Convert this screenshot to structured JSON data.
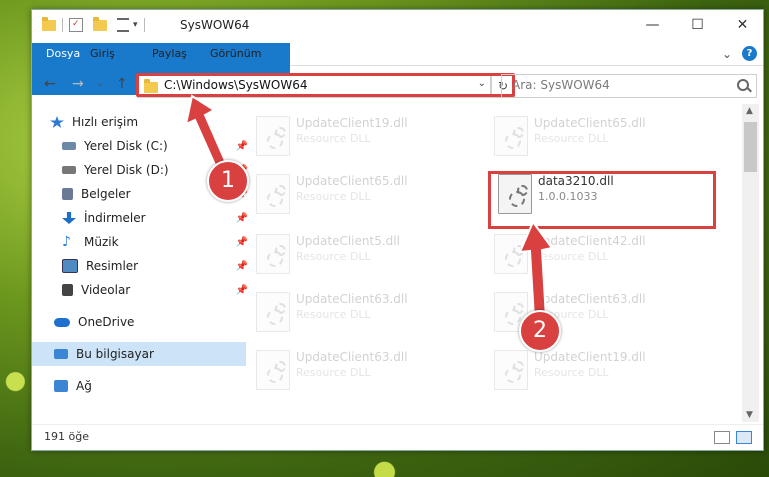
{
  "window": {
    "title": "SysWOW64",
    "buttons": {
      "minimize": "—",
      "maximize": "☐",
      "close": "✕"
    }
  },
  "ribbon": {
    "tabs": [
      "Dosya",
      "Giriş",
      "Paylaş",
      "Görünüm"
    ],
    "help": "?",
    "expand": "⌄"
  },
  "nav": {
    "back": "←",
    "forward": "→",
    "recent": "⌄",
    "up": "↑",
    "address": "C:\\Windows\\SysWOW64",
    "address_dropdown": "⌄",
    "refresh": "↻",
    "search_placeholder": "Ara: SysWOW64"
  },
  "sidebar": {
    "items": [
      {
        "label": "Hızlı erişim",
        "icon": "star-icon",
        "color": "#2d7bd1"
      },
      {
        "label": "Yerel Disk (C:)",
        "icon": "drive-icon",
        "color": "#6c8aa8"
      },
      {
        "label": "Yerel Disk (D:)",
        "icon": "drive-icon",
        "color": "#777777"
      },
      {
        "label": "Belgeler",
        "icon": "document-icon",
        "color": "#6a7a96"
      },
      {
        "label": "İndirmeler",
        "icon": "download-icon",
        "color": "#1b6fc9"
      },
      {
        "label": "Müzik",
        "icon": "music-icon",
        "color": "#2a7fd4"
      },
      {
        "label": "Resimler",
        "icon": "pictures-icon",
        "color": "#4f8bc0"
      },
      {
        "label": "Videolar",
        "icon": "video-icon",
        "color": "#444444"
      },
      {
        "label": "OneDrive",
        "icon": "cloud-icon",
        "color": "#1f6fce"
      },
      {
        "label": "Bu bilgisayar",
        "icon": "computer-icon",
        "color": "#3b86d4"
      },
      {
        "label": "Ağ",
        "icon": "network-icon",
        "color": "#3b86d4"
      }
    ]
  },
  "files": [
    {
      "name": "UpdateClient19.dll",
      "desc": "Resource DLL"
    },
    {
      "name": "UpdateClient65.dll",
      "desc": "Resource DLL"
    },
    {
      "name": "UpdateClient65.dll",
      "desc": "Resource DLL"
    },
    {
      "name": "data3210.dll",
      "desc": "1.0.0.1033"
    },
    {
      "name": "UpdateClient5.dll",
      "desc": "Resource DLL"
    },
    {
      "name": "UpdateClient42.dll",
      "desc": "Resource DLL"
    },
    {
      "name": "UpdateClient63.dll",
      "desc": "Resource DLL"
    },
    {
      "name": "UpdateClient63.dll",
      "desc": "Resource DLL"
    },
    {
      "name": "UpdateClient63.dll",
      "desc": "Resource DLL"
    },
    {
      "name": "UpdateClient19.dll",
      "desc": "Resource DLL"
    }
  ],
  "status": {
    "count": "191 öğe"
  },
  "annotations": {
    "callout1": "1",
    "callout2": "2",
    "color": "#d94040"
  }
}
